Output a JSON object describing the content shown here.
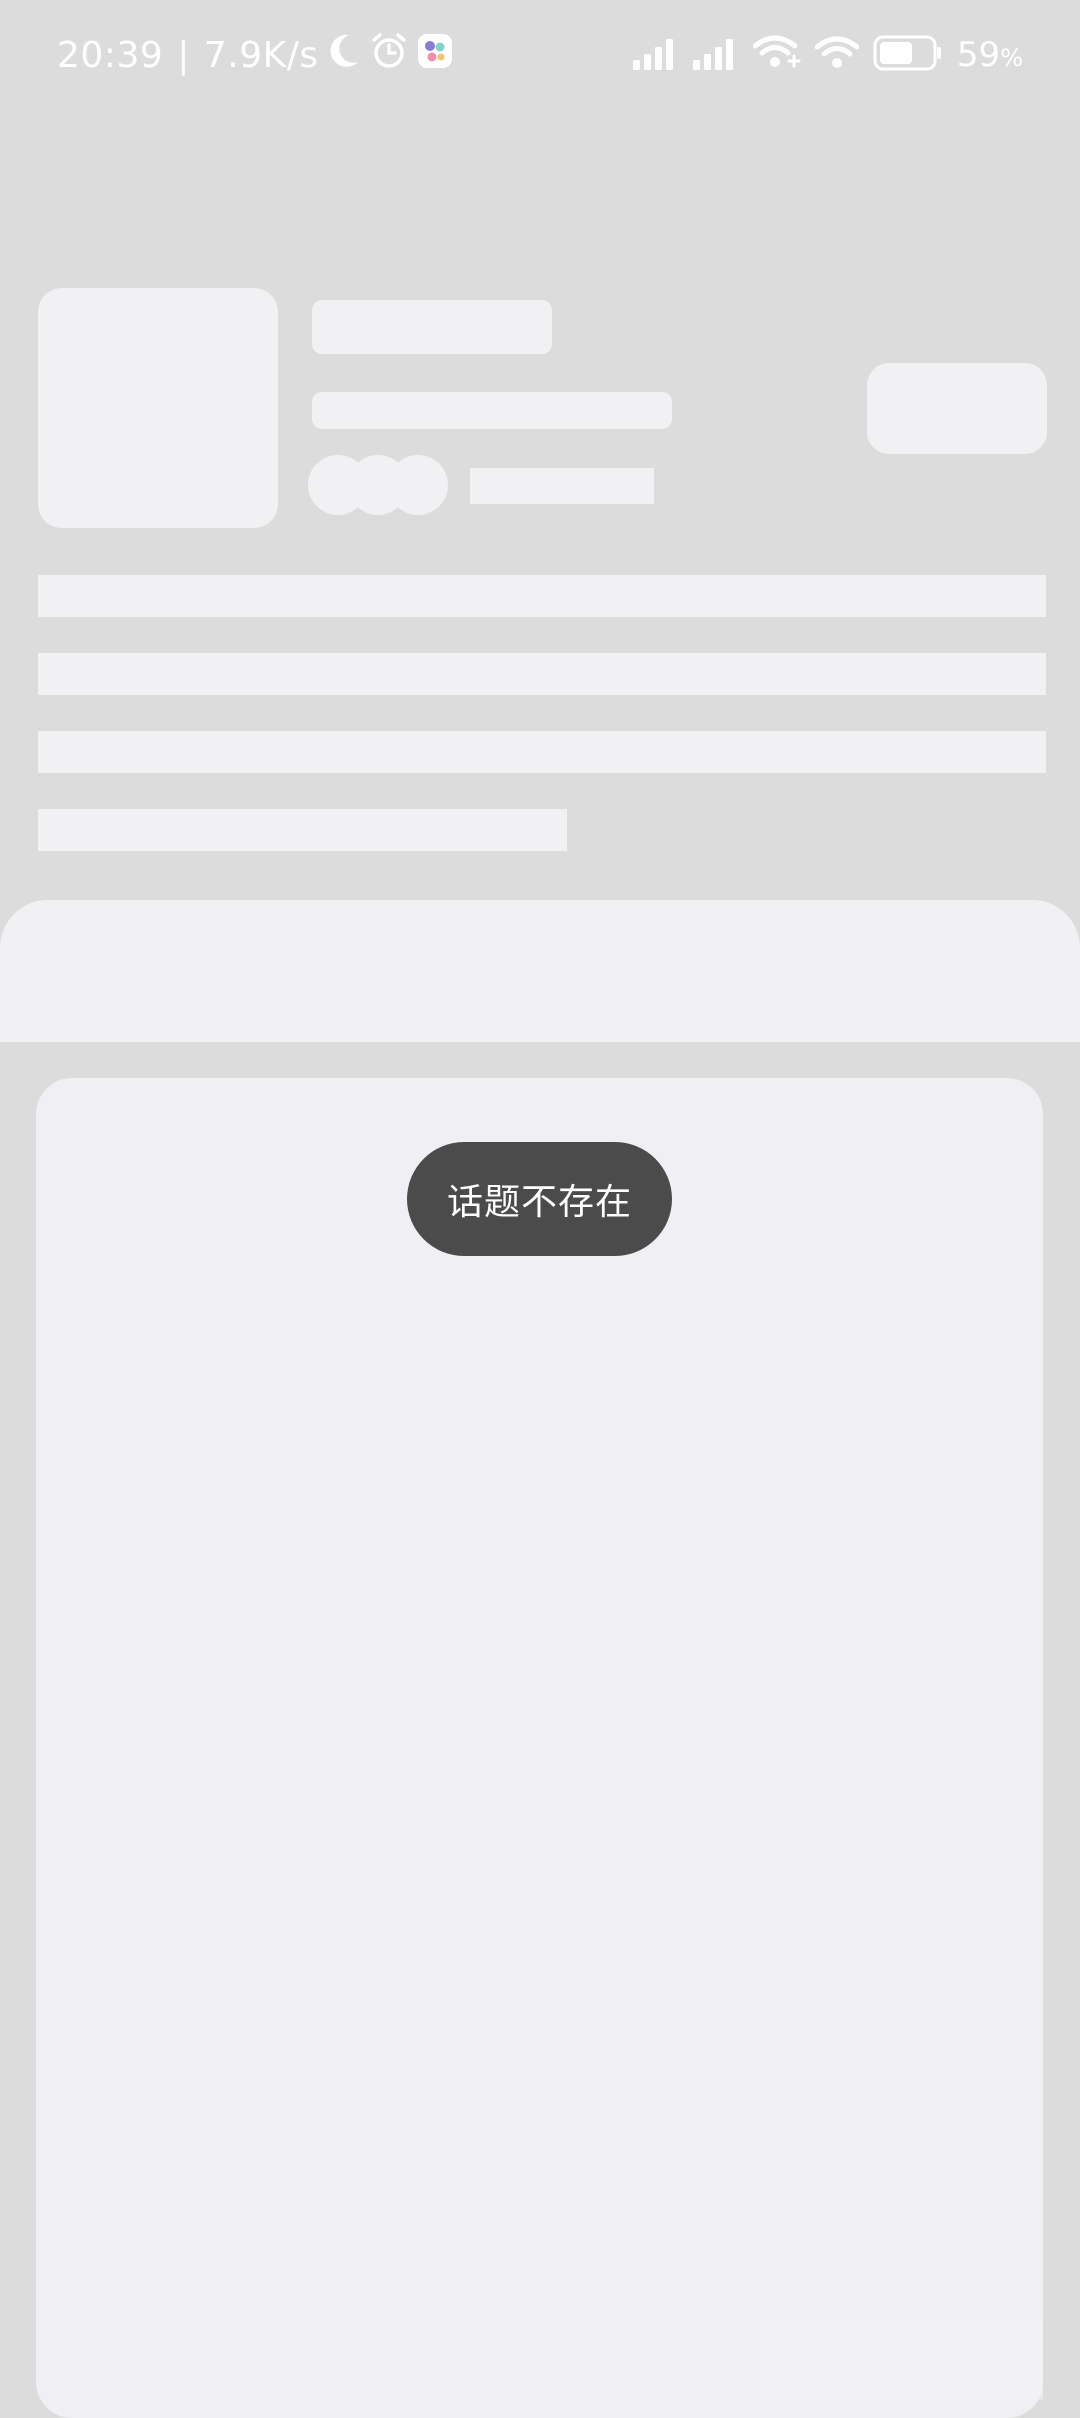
{
  "status_bar": {
    "time": "20:39",
    "separator": "|",
    "network_speed": "7.9K/s",
    "battery_percent": "59",
    "battery_unit": "%",
    "icons": [
      "moon-icon",
      "alarm-icon",
      "app-notification-icon",
      "signal-icon",
      "signal-icon",
      "wifi-plus-icon",
      "wifi-icon",
      "battery-icon"
    ]
  },
  "toast": {
    "message": "话题不存在"
  },
  "colors": {
    "background": "#dcdcdc",
    "skeleton": "#f1f1f4",
    "toast_bg": "#4b4b4b"
  }
}
